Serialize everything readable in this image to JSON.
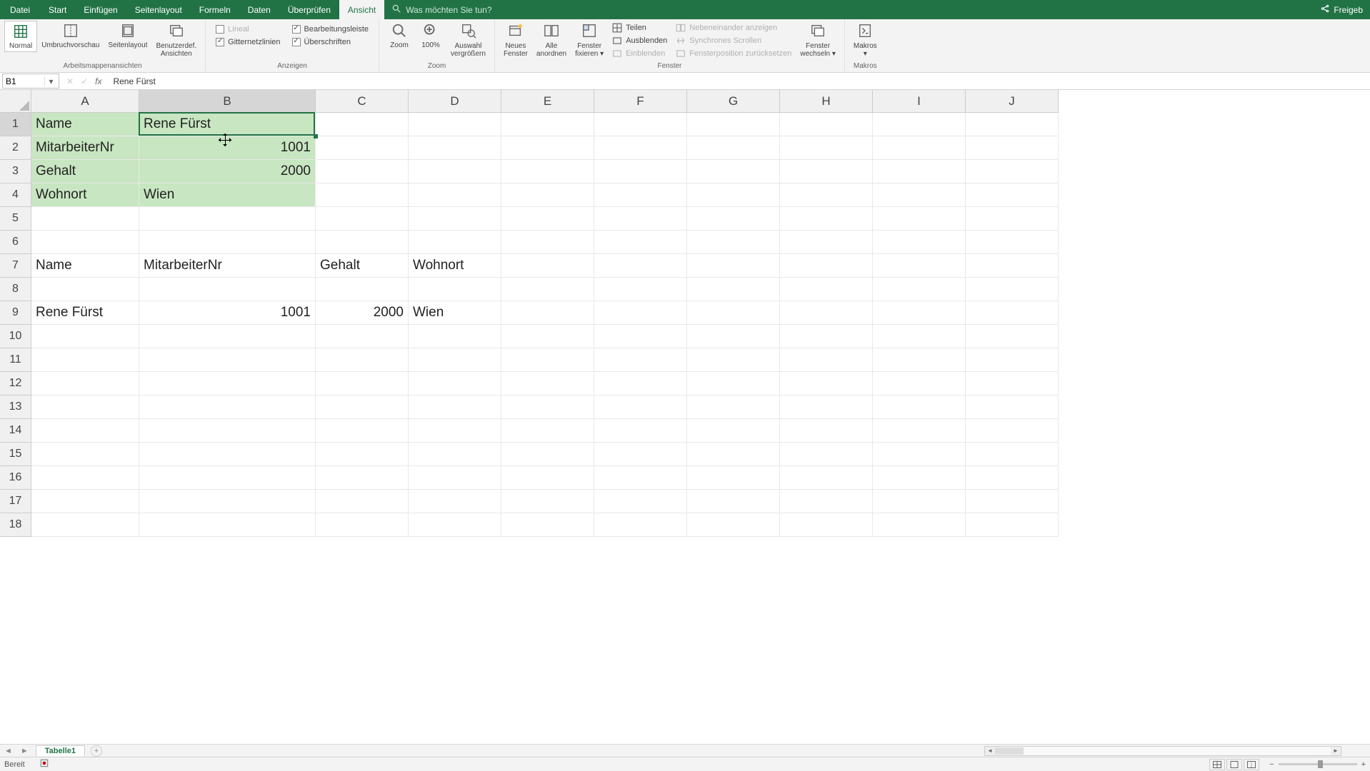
{
  "titlebar": {
    "tabs": [
      "Datei",
      "Start",
      "Einfügen",
      "Seitenlayout",
      "Formeln",
      "Daten",
      "Überprüfen",
      "Ansicht"
    ],
    "active_tab": "Ansicht",
    "search_placeholder": "Was möchten Sie tun?",
    "share_label": "Freigeb"
  },
  "ribbon": {
    "group_views": {
      "label": "Arbeitsmappenansichten",
      "normal": "Normal",
      "umbruch": "Umbruchvorschau",
      "seitenlayout": "Seitenlayout",
      "benutzer1": "Benutzerdef.",
      "benutzer2": "Ansichten"
    },
    "group_anzeigen": {
      "label": "Anzeigen",
      "lineal": "Lineal",
      "bearbeitungsleiste": "Bearbeitungsleiste",
      "gitternetz": "Gitternetzlinien",
      "ueberschriften": "Überschriften"
    },
    "group_zoom": {
      "label": "Zoom",
      "zoom": "Zoom",
      "hundred": "100%",
      "auswahl1": "Auswahl",
      "auswahl2": "vergrößern"
    },
    "group_fenster": {
      "label": "Fenster",
      "neues1": "Neues",
      "neues2": "Fenster",
      "alle1": "Alle",
      "alle2": "anordnen",
      "fix1": "Fenster",
      "fix2": "fixieren",
      "teilen": "Teilen",
      "ausblenden": "Ausblenden",
      "einblenden": "Einblenden",
      "nebeneinander": "Nebeneinander anzeigen",
      "synchron": "Synchrones Scrollen",
      "fensterpos": "Fensterposition zurücksetzen",
      "wechseln1": "Fenster",
      "wechseln2": "wechseln"
    },
    "group_makros": {
      "label": "Makros",
      "makros": "Makros"
    }
  },
  "formula_bar": {
    "cell_ref": "B1",
    "formula": "Rene Fürst"
  },
  "columns": {
    "letters": [
      "A",
      "B",
      "C",
      "D",
      "E",
      "F",
      "G",
      "H",
      "I",
      "J"
    ],
    "widths": [
      151,
      247,
      130,
      130,
      130,
      130,
      130,
      130,
      130,
      130
    ],
    "selected_index": 1
  },
  "rows": {
    "count": 18,
    "height": 33,
    "selected_index": 0
  },
  "cells": {
    "A1": "Name",
    "B1": "Rene Fürst",
    "A2": "MitarbeiterNr",
    "B2": "1001",
    "A3": "Gehalt",
    "B3": "2000",
    "A4": "Wohnort",
    "B4": "Wien",
    "A7": "Name",
    "B7": "MitarbeiterNr",
    "C7": "Gehalt",
    "D7": "Wohnort",
    "A9": "Rene Fürst",
    "B9": "1001",
    "C9": "2000",
    "D9": "Wien"
  },
  "green_range": {
    "rows": [
      0,
      3
    ],
    "cols": [
      0,
      1
    ]
  },
  "selection": {
    "row": 0,
    "col": 1
  },
  "sheet_tabs": {
    "active": "Tabelle1"
  },
  "statusbar": {
    "ready": "Bereit"
  }
}
